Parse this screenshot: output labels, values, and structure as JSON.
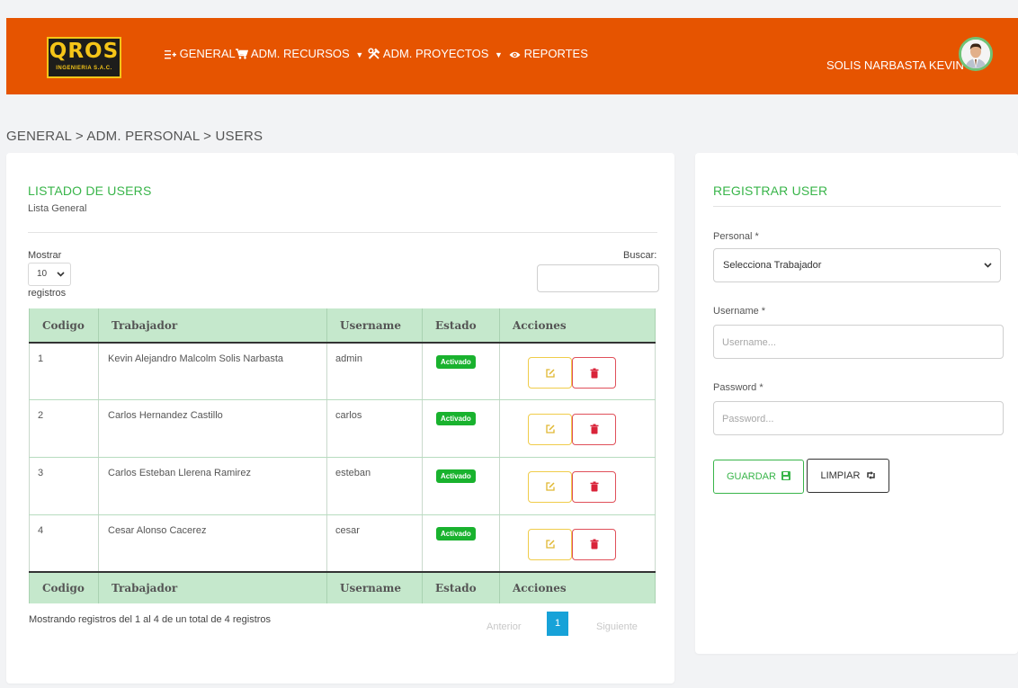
{
  "brand": {
    "logo_text": "QROS",
    "logo_subtext": "INGENIERIA S.A.C.",
    "color_primary": "#e65400",
    "color_logo": "#f5c518"
  },
  "nav": {
    "items": [
      {
        "label": "GENERAL",
        "icon": "list-plus-icon",
        "dropdown": true
      },
      {
        "label": "ADM. RECURSOS",
        "icon": "cart-icon",
        "dropdown": true
      },
      {
        "label": "ADM. PROYECTOS",
        "icon": "tools-icon",
        "dropdown": true
      },
      {
        "label": "REPORTES",
        "icon": "eye-icon",
        "dropdown": false
      }
    ],
    "user_name": "SOLIS NARBASTA KEVIN"
  },
  "breadcrumb": "GENERAL > ADM. PERSONAL > USERS",
  "list": {
    "title": "LISTADO DE USERS",
    "subtitle": "Lista General",
    "show_label": "Mostrar",
    "page_length": "10",
    "records_label": "registros",
    "search_label": "Buscar:",
    "columns": [
      "Codigo",
      "Trabajador",
      "Username",
      "Estado",
      "Acciones"
    ],
    "rows": [
      {
        "codigo": "1",
        "trabajador": "Kevin Alejandro Malcolm Solis Narbasta",
        "username": "admin",
        "estado": "Activado"
      },
      {
        "codigo": "2",
        "trabajador": "Carlos Hernandez Castillo",
        "username": "carlos",
        "estado": "Activado"
      },
      {
        "codigo": "3",
        "trabajador": "Carlos Esteban Llerena Ramirez",
        "username": "esteban",
        "estado": "Activado"
      },
      {
        "codigo": "4",
        "trabajador": "Cesar Alonso Cacerez",
        "username": "cesar",
        "estado": "Activado"
      }
    ],
    "info": "Mostrando registros del 1 al 4 de un total de 4 registros",
    "pagination": {
      "prev": "Anterior",
      "current": "1",
      "next": "Siguiente"
    },
    "color_header": "#c5e8cc",
    "color_badge": "#19b22e"
  },
  "form": {
    "title": "REGISTRAR USER",
    "personal_label": "Personal *",
    "personal_value": "Selecciona Trabajador",
    "username_label": "Username *",
    "username_placeholder": "Username...",
    "password_label": "Password *",
    "password_placeholder": "Password...",
    "save_label": "GUARDAR",
    "clear_label": "LIMPIAR",
    "color_accent": "#39b54a"
  }
}
